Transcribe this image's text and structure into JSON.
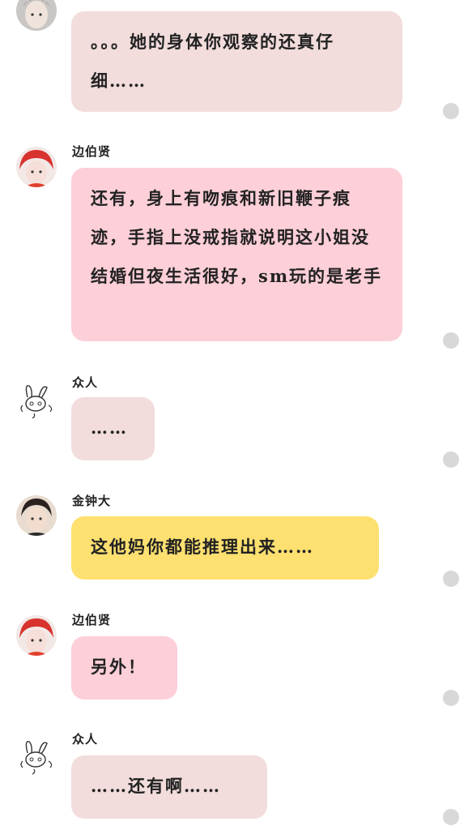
{
  "messages": [
    {
      "name": "",
      "text": "。。。她的身体你观察的还真仔细……",
      "bubble_color": "#f2dcdc",
      "avatar": "boy-gray-avatar"
    },
    {
      "name": "边伯贤",
      "text": "还有，身上有吻痕和新旧鞭子痕迹，手指上没戒指就说明这小姐没结婚但夜生活很好，sm玩的是老手",
      "bubble_color": "#fdcfd8",
      "avatar": "red-hair-boy-avatar"
    },
    {
      "name": "众人",
      "text": "……",
      "bubble_color": "#f2dcdc",
      "avatar": "rabbit-sketch-avatar"
    },
    {
      "name": "金钟大",
      "text": "这他妈你都能推理出来……",
      "bubble_color": "#fde070",
      "avatar": "dark-hair-boy-avatar"
    },
    {
      "name": "边伯贤",
      "text": "另外！",
      "bubble_color": "#fdcfd8",
      "avatar": "red-hair-boy-avatar"
    },
    {
      "name": "众人",
      "text": "……还有啊……",
      "bubble_color": "#f2dcdc",
      "avatar": "rabbit-sketch-avatar"
    }
  ]
}
